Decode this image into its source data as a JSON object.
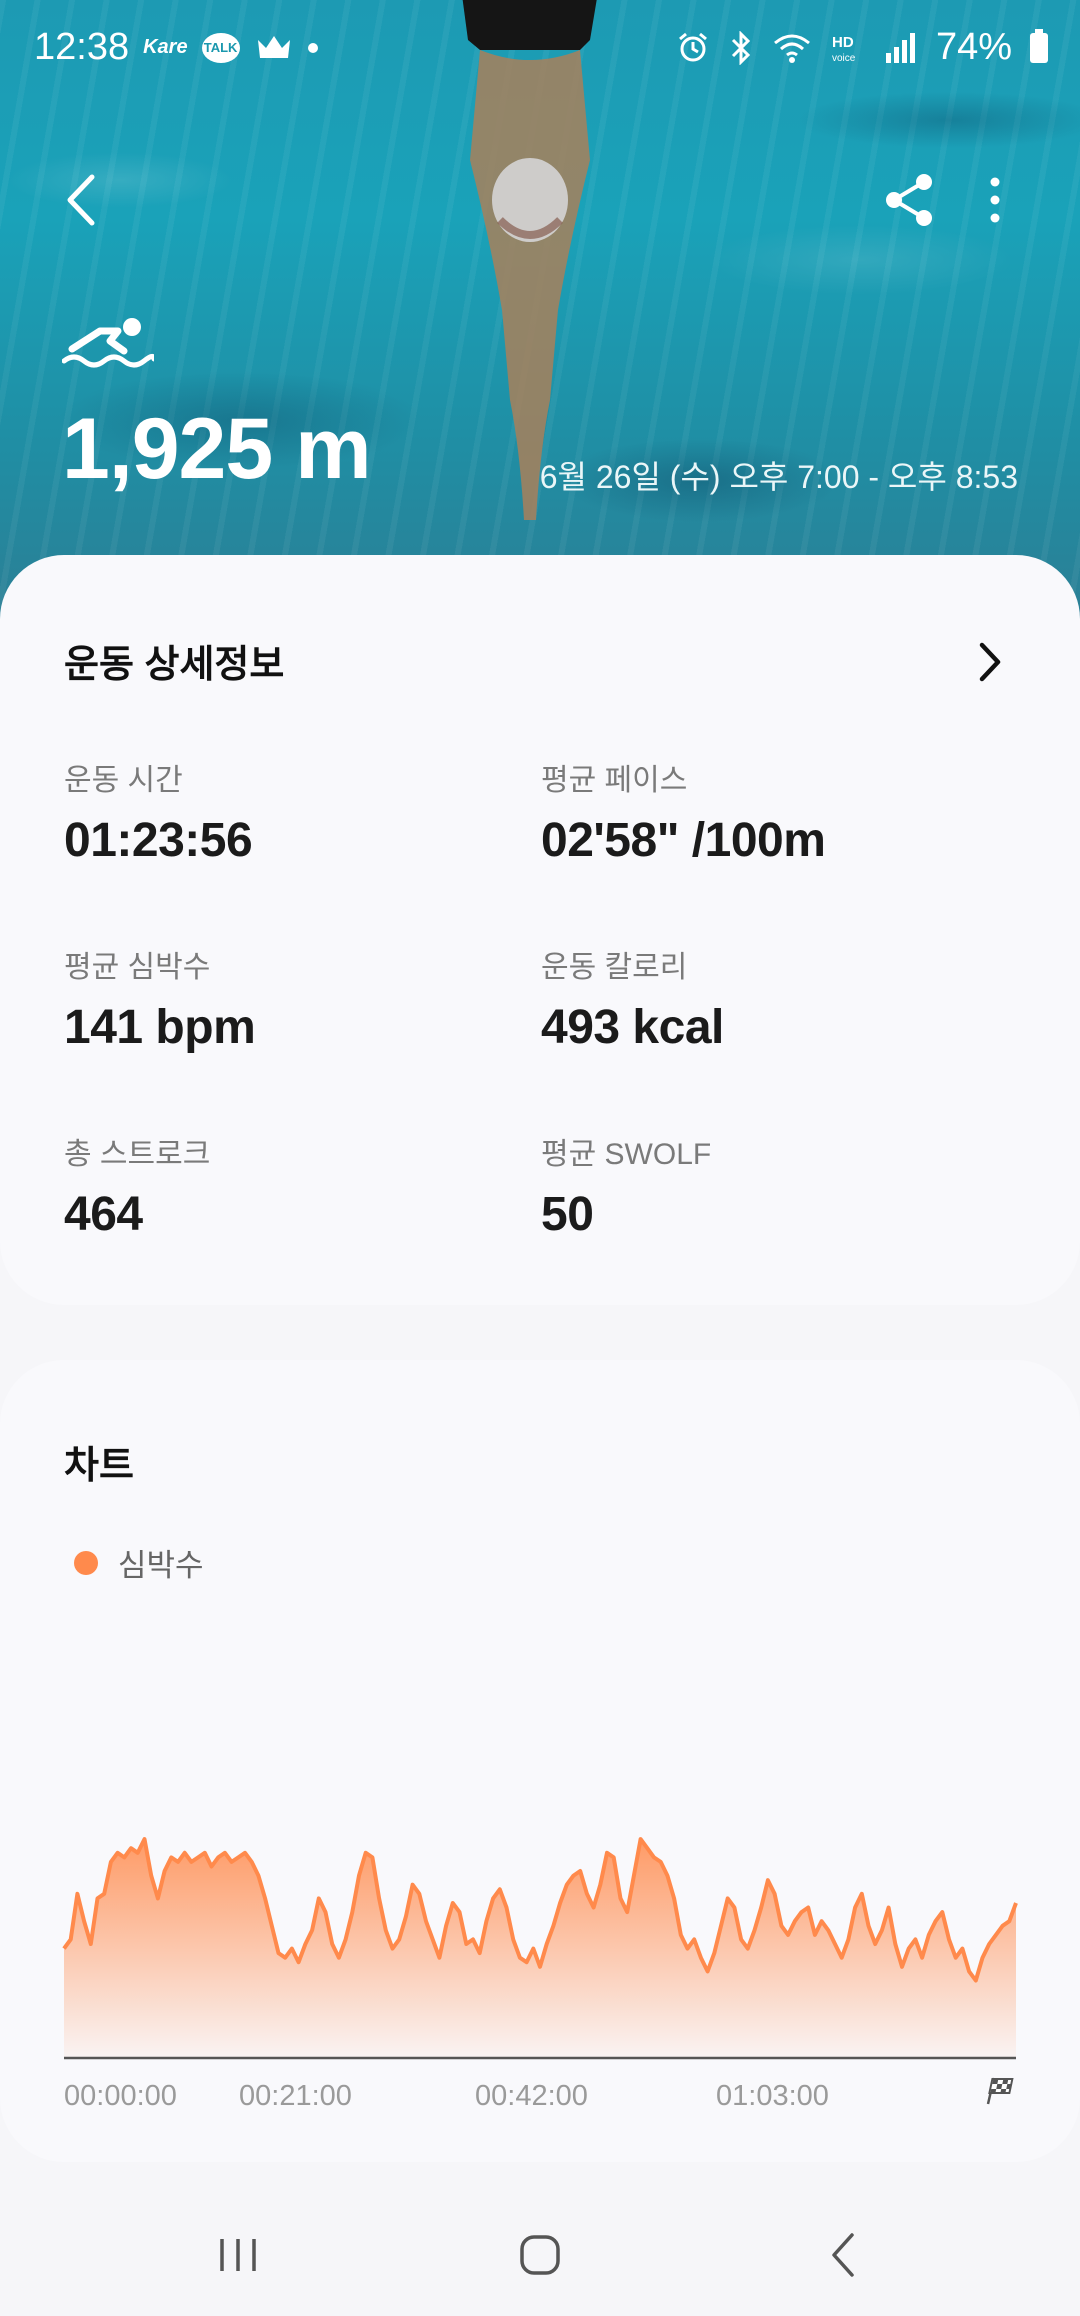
{
  "status_bar": {
    "time": "12:38",
    "app_label": "Kare",
    "talk_label": "TALK",
    "battery": "74%"
  },
  "header": {
    "distance": "1,925 m",
    "datetime": "6월 26일 (수) 오후 7:00 - 오후 8:53"
  },
  "details": {
    "title": "운동 상세정보",
    "metrics": [
      {
        "label": "운동 시간",
        "value": "01:23:56"
      },
      {
        "label": "평균 페이스",
        "value": "02'58\" /100m"
      },
      {
        "label": "평균 심박수",
        "value": "141 bpm"
      },
      {
        "label": "운동 칼로리",
        "value": "493 kcal"
      },
      {
        "label": "총 스트로크",
        "value": "464"
      },
      {
        "label": "평균 SWOLF",
        "value": "50"
      }
    ]
  },
  "chart_section": {
    "title": "차트",
    "legend": "심박수"
  },
  "colors": {
    "accent": "#ff8a4c",
    "card_bg": "#f9f9fc",
    "page_bg": "#f6f6f9"
  },
  "chart_data": {
    "type": "area",
    "series": [
      {
        "name": "심박수",
        "values": [
          108,
          112,
          132,
          120,
          110,
          130,
          132,
          146,
          150,
          148,
          152,
          150,
          156,
          140,
          130,
          142,
          148,
          146,
          150,
          146,
          148,
          150,
          144,
          148,
          150,
          146,
          148,
          150,
          146,
          140,
          130,
          118,
          106,
          104,
          108,
          102,
          110,
          116,
          130,
          124,
          110,
          104,
          112,
          124,
          140,
          150,
          148,
          130,
          116,
          108,
          112,
          122,
          136,
          132,
          120,
          112,
          104,
          118,
          128,
          124,
          110,
          112,
          106,
          120,
          130,
          134,
          126,
          112,
          104,
          102,
          108,
          100,
          110,
          118,
          128,
          136,
          140,
          142,
          132,
          126,
          136,
          150,
          148,
          130,
          124,
          140,
          156,
          152,
          148,
          146,
          140,
          130,
          114,
          108,
          112,
          104,
          98,
          106,
          118,
          130,
          126,
          112,
          108,
          116,
          126,
          138,
          132,
          118,
          114,
          120,
          124,
          126,
          114,
          120,
          116,
          110,
          104,
          112,
          126,
          132,
          118,
          110,
          116,
          126,
          110,
          100,
          108,
          112,
          104,
          114,
          120,
          124,
          112,
          104,
          108,
          98,
          94,
          104,
          110,
          114,
          118,
          120,
          128
        ]
      }
    ],
    "x_ticks": [
      "00:00:00",
      "00:21:00",
      "00:42:00",
      "01:03:00"
    ]
  }
}
